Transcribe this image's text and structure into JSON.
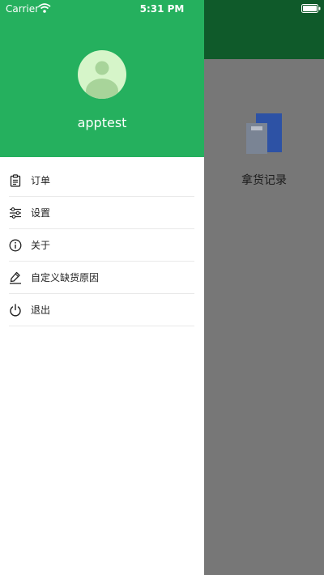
{
  "status_bar": {
    "carrier": "Carrier",
    "time": "5:31 PM"
  },
  "drawer": {
    "username": "apptest",
    "menu": [
      {
        "label": "订单",
        "icon": "clipboard-icon"
      },
      {
        "label": "设置",
        "icon": "sliders-icon"
      },
      {
        "label": "关于",
        "icon": "info-icon"
      },
      {
        "label": "自定义缺货原因",
        "icon": "pen-icon"
      },
      {
        "label": "退出",
        "icon": "power-icon"
      }
    ]
  },
  "background": {
    "card_label": "拿货记录"
  },
  "colors": {
    "drawer_header": "#25b05e",
    "page_header": "#0f5a2a",
    "overlay": "#777777",
    "avatar_bg": "#d6f5c9"
  }
}
